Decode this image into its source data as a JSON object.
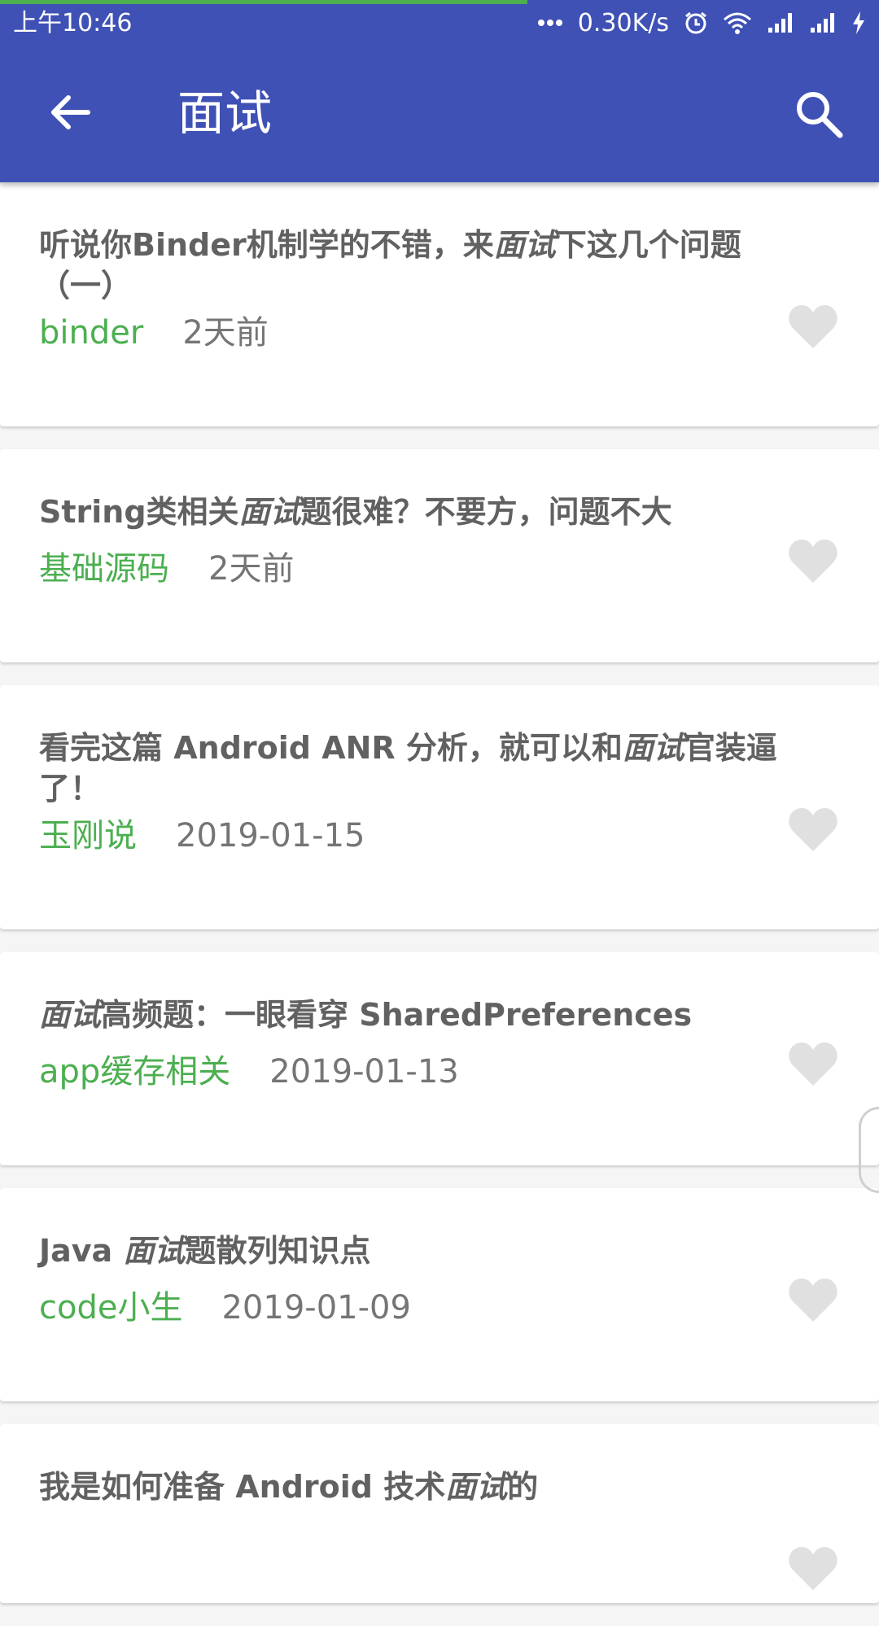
{
  "status_bar": {
    "time": "上午10:46",
    "network_speed": "0.30K/s",
    "top_progress_percent": 60,
    "icons": [
      "more-dots-icon",
      "alarm-icon",
      "wifi-icon",
      "signal-icon",
      "signal-icon",
      "charging-icon"
    ]
  },
  "app_bar": {
    "title": "面试",
    "back_icon": "arrow-back-icon",
    "search_icon": "search-icon"
  },
  "articles": [
    {
      "title_parts": [
        {
          "text": "听说你Binder机制学的不错，来",
          "em": false
        },
        {
          "text": "面试",
          "em": true
        },
        {
          "text": "下这几个问题（一）",
          "em": false
        }
      ],
      "tag": "binder",
      "date": "2天前",
      "liked": false
    },
    {
      "title_parts": [
        {
          "text": "String类相关",
          "em": false
        },
        {
          "text": "面试",
          "em": true
        },
        {
          "text": "题很难？不要方，问题不大",
          "em": false
        }
      ],
      "tag": "基础源码",
      "date": "2天前",
      "liked": false
    },
    {
      "title_parts": [
        {
          "text": "看完这篇 Android ANR 分析，就可以和",
          "em": false
        },
        {
          "text": "面试",
          "em": true
        },
        {
          "text": "官装逼了！",
          "em": false
        }
      ],
      "tag": "玉刚说",
      "date": "2019-01-15",
      "liked": false
    },
    {
      "title_parts": [
        {
          "text": "面试",
          "em": true
        },
        {
          "text": "高频题：一眼看穿 SharedPreferences",
          "em": false
        }
      ],
      "tag": "app缓存相关",
      "date": "2019-01-13",
      "liked": false
    },
    {
      "title_parts": [
        {
          "text": "Java ",
          "em": false
        },
        {
          "text": "面试",
          "em": true
        },
        {
          "text": "题散列知识点",
          "em": false
        }
      ],
      "tag": "code小生",
      "date": "2019-01-09",
      "liked": false
    },
    {
      "title_parts": [
        {
          "text": "我是如何准备 Android 技术",
          "em": false
        },
        {
          "text": "面试",
          "em": true
        },
        {
          "text": "的",
          "em": false
        }
      ],
      "tag": "",
      "date": "",
      "liked": false
    }
  ],
  "colors": {
    "primary": "#3f51b5",
    "accent_green": "#4caf50",
    "title_text": "#616161",
    "meta_text": "#757575",
    "heart_inactive": "#e0e0e0"
  }
}
